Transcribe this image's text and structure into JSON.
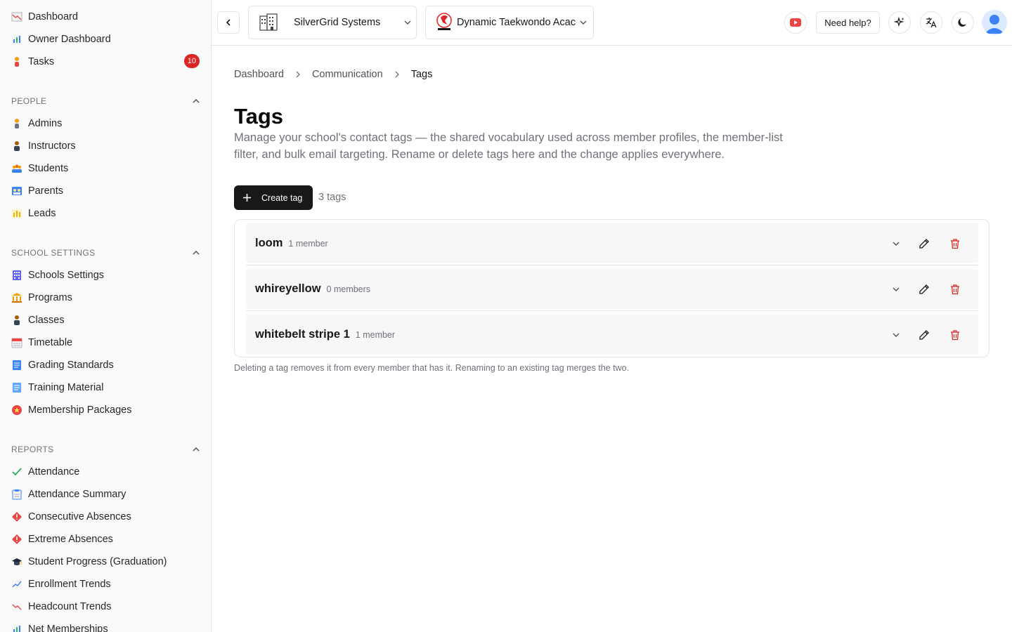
{
  "sidebar": {
    "top_items": [
      {
        "label": "Dashboard",
        "icon": "chart-down-icon"
      },
      {
        "label": "Owner Dashboard",
        "icon": "bar-chart-icon"
      },
      {
        "label": "Tasks",
        "icon": "person-icon",
        "badge": "10"
      }
    ],
    "sections": [
      {
        "title": "PEOPLE",
        "items": [
          {
            "label": "Admins",
            "icon": "person-icon"
          },
          {
            "label": "Instructors",
            "icon": "teacher-icon"
          },
          {
            "label": "Students",
            "icon": "group-icon"
          },
          {
            "label": "Parents",
            "icon": "family-icon"
          },
          {
            "label": "Leads",
            "icon": "bar-chart-icon"
          }
        ]
      },
      {
        "title": "SCHOOL SETTINGS",
        "items": [
          {
            "label": "Schools Settings",
            "icon": "building-icon"
          },
          {
            "label": "Programs",
            "icon": "classical-building-icon"
          },
          {
            "label": "Classes",
            "icon": "person-icon"
          },
          {
            "label": "Timetable",
            "icon": "calendar-icon"
          },
          {
            "label": "Grading Standards",
            "icon": "document-icon"
          },
          {
            "label": "Training Material",
            "icon": "document-icon"
          },
          {
            "label": "Membership Packages",
            "icon": "medal-icon"
          }
        ]
      },
      {
        "title": "REPORTS",
        "items": [
          {
            "label": "Attendance",
            "icon": "check-icon"
          },
          {
            "label": "Attendance Summary",
            "icon": "clipboard-icon"
          },
          {
            "label": "Consecutive Absences",
            "icon": "warning-diamond-icon"
          },
          {
            "label": "Extreme Absences",
            "icon": "warning-diamond-icon"
          },
          {
            "label": "Student Progress (Graduation)",
            "icon": "graduation-cap-icon"
          },
          {
            "label": "Enrollment Trends",
            "icon": "chart-up-icon"
          },
          {
            "label": "Headcount Trends",
            "icon": "chart-down-icon"
          },
          {
            "label": "Net Memberships",
            "icon": "bar-chart-icon"
          }
        ]
      }
    ]
  },
  "topbar": {
    "org_name": "SilverGrid Systems",
    "school_name": "Dynamic Taekwondo Acac",
    "help_label": "Need help?"
  },
  "breadcrumb": [
    "Dashboard",
    "Communication",
    "Tags"
  ],
  "page": {
    "title": "Tags",
    "description": "Manage your school's contact tags — the shared vocabulary used across member profiles, the member-list filter, and bulk email targeting. Rename or delete tags here and the change applies everywhere.",
    "create_label": "Create tag",
    "tag_count": "3 tags",
    "footnote": "Deleting a tag removes it from every member that has it. Renaming to an existing tag merges the two."
  },
  "tags": [
    {
      "name": "loom",
      "members": "1 member"
    },
    {
      "name": "whireyellow",
      "members": "0 members"
    },
    {
      "name": "whitebelt stripe 1",
      "members": "1 member"
    }
  ],
  "colors": {
    "accent": "#18181b",
    "badge": "#dc2626",
    "delete": "#dc2626",
    "youtube": "#ef4444"
  }
}
